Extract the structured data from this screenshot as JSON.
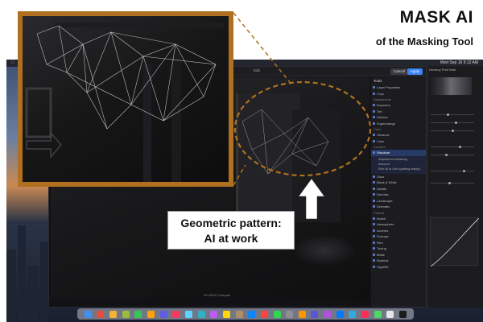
{
  "headline": {
    "title": "MASK AI",
    "subtitle": "of the Masking Tool"
  },
  "callout": {
    "line1": "Geometric pattern:",
    "line2": "AI at work"
  },
  "menubar": {
    "clock": "Wed Sep 16 9:12 AM"
  },
  "app": {
    "edit_label": "Edit",
    "cancel_label": "Cancel",
    "apply_label": "Apply",
    "tools_title": "Tools",
    "tools": [
      {
        "type": "item",
        "label": "Layer Properties"
      },
      {
        "type": "item",
        "label": "Crop"
      },
      {
        "type": "section",
        "label": "Adjustments"
      },
      {
        "type": "item",
        "label": "Exposure"
      },
      {
        "type": "item",
        "label": "Tint"
      },
      {
        "type": "item",
        "label": "Dehaze"
      },
      {
        "type": "item",
        "label": "Supercharge"
      },
      {
        "type": "section",
        "label": "Color"
      },
      {
        "type": "item",
        "label": "Vibrance"
      },
      {
        "type": "item",
        "label": "Color"
      },
      {
        "type": "section",
        "label": "Creative"
      },
      {
        "type": "active",
        "label": "Structure"
      }
    ],
    "structure_rows": [
      "Adjustment   Masking",
      "Amount",
      "Run AI in Gen (getting ready)"
    ],
    "tools_more": [
      {
        "type": "item",
        "label": "Glow"
      },
      {
        "type": "item",
        "label": "Black & White"
      },
      {
        "type": "item",
        "label": "Details"
      },
      {
        "type": "item",
        "label": "Denoise"
      },
      {
        "type": "item",
        "label": "Landscape"
      },
      {
        "type": "item",
        "label": "Dramatic"
      },
      {
        "type": "section",
        "label": "Portrait"
      },
      {
        "type": "item",
        "label": "Bokeh"
      },
      {
        "type": "item",
        "label": "Atmosphere"
      },
      {
        "type": "item",
        "label": "Accents"
      },
      {
        "type": "item",
        "label": "Sunrays"
      },
      {
        "type": "item",
        "label": "Film"
      },
      {
        "type": "item",
        "label": "Toning"
      },
      {
        "type": "item",
        "label": "Matte"
      },
      {
        "type": "item",
        "label": "Mystical"
      },
      {
        "type": "item",
        "label": "Vignette"
      }
    ],
    "bottom_bar": "Fit   100%   Compare"
  },
  "rightpanel": {
    "tabs": "Develop  Print  Web"
  },
  "colors": {
    "accent": "#b07020",
    "apply_blue": "#3b82f6",
    "active_tool": "#283a66"
  },
  "dock_colors": [
    "#3f8ef5",
    "#e84c3d",
    "#f2b233",
    "#9bbd3c",
    "#34c759",
    "#ff9f0a",
    "#5e5ce6",
    "#ff375f",
    "#64d2ff",
    "#30b0c7",
    "#bf5af2",
    "#ffd60a",
    "#ac8e68",
    "#0a84ff",
    "#ff453a",
    "#32d74b",
    "#8e8e93",
    "#ff9500",
    "#5856d6",
    "#af52de",
    "#007aff",
    "#34aadc",
    "#ff2d55",
    "#4cd964",
    "#e5e5ea",
    "#1c1c1e"
  ]
}
